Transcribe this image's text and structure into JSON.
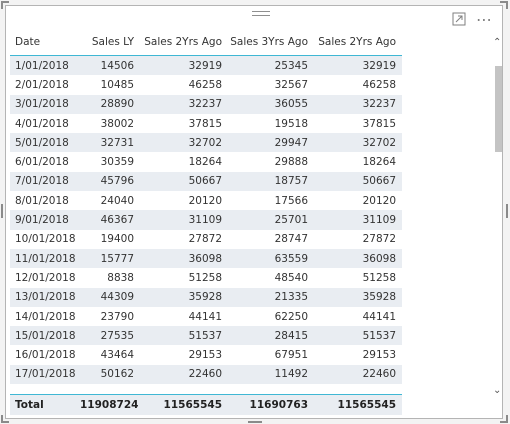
{
  "table": {
    "headers": [
      "Date",
      "Sales LY",
      "Sales 2Yrs Ago",
      "Sales 3Yrs Ago",
      "Sales 2Yrs Ago"
    ],
    "rows": [
      [
        "1/01/2018",
        "14506",
        "32919",
        "25345",
        "32919"
      ],
      [
        "2/01/2018",
        "10485",
        "46258",
        "32567",
        "46258"
      ],
      [
        "3/01/2018",
        "28890",
        "32237",
        "36055",
        "32237"
      ],
      [
        "4/01/2018",
        "38002",
        "37815",
        "19518",
        "37815"
      ],
      [
        "5/01/2018",
        "32731",
        "32702",
        "29947",
        "32702"
      ],
      [
        "6/01/2018",
        "30359",
        "18264",
        "29888",
        "18264"
      ],
      [
        "7/01/2018",
        "45796",
        "50667",
        "18757",
        "50667"
      ],
      [
        "8/01/2018",
        "24040",
        "20120",
        "17566",
        "20120"
      ],
      [
        "9/01/2018",
        "46367",
        "31109",
        "25701",
        "31109"
      ],
      [
        "10/01/2018",
        "19400",
        "27872",
        "28747",
        "27872"
      ],
      [
        "11/01/2018",
        "15777",
        "36098",
        "63559",
        "36098"
      ],
      [
        "12/01/2018",
        "8838",
        "51258",
        "48540",
        "51258"
      ],
      [
        "13/01/2018",
        "44309",
        "35928",
        "21335",
        "35928"
      ],
      [
        "14/01/2018",
        "23790",
        "44141",
        "62250",
        "44141"
      ],
      [
        "15/01/2018",
        "27535",
        "51537",
        "28415",
        "51537"
      ],
      [
        "16/01/2018",
        "43464",
        "29153",
        "67951",
        "29153"
      ],
      [
        "17/01/2018",
        "50162",
        "22460",
        "11492",
        "22460"
      ]
    ],
    "total": [
      "Total",
      "11908724",
      "11565545",
      "11690763",
      "11565545"
    ]
  },
  "icons": {
    "focus_mode": "expand-icon",
    "more_options": "more-options-icon",
    "scroll_up": "chevron-up-icon",
    "scroll_down": "chevron-down-icon"
  },
  "colors": {
    "accent": "#3fb7d4",
    "banding": "#e9edf2",
    "border": "#b4b4b4"
  }
}
